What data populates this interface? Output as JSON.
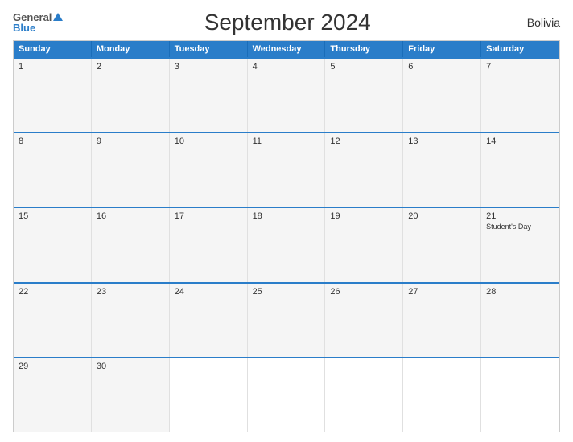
{
  "header": {
    "logo_general": "General",
    "logo_blue": "Blue",
    "title": "September 2024",
    "country": "Bolivia"
  },
  "day_headers": [
    "Sunday",
    "Monday",
    "Tuesday",
    "Wednesday",
    "Thursday",
    "Friday",
    "Saturday"
  ],
  "weeks": [
    [
      {
        "day": "1",
        "holiday": ""
      },
      {
        "day": "2",
        "holiday": ""
      },
      {
        "day": "3",
        "holiday": ""
      },
      {
        "day": "4",
        "holiday": ""
      },
      {
        "day": "5",
        "holiday": ""
      },
      {
        "day": "6",
        "holiday": ""
      },
      {
        "day": "7",
        "holiday": ""
      }
    ],
    [
      {
        "day": "8",
        "holiday": ""
      },
      {
        "day": "9",
        "holiday": ""
      },
      {
        "day": "10",
        "holiday": ""
      },
      {
        "day": "11",
        "holiday": ""
      },
      {
        "day": "12",
        "holiday": ""
      },
      {
        "day": "13",
        "holiday": ""
      },
      {
        "day": "14",
        "holiday": ""
      }
    ],
    [
      {
        "day": "15",
        "holiday": ""
      },
      {
        "day": "16",
        "holiday": ""
      },
      {
        "day": "17",
        "holiday": ""
      },
      {
        "day": "18",
        "holiday": ""
      },
      {
        "day": "19",
        "holiday": ""
      },
      {
        "day": "20",
        "holiday": ""
      },
      {
        "day": "21",
        "holiday": "Student's Day"
      }
    ],
    [
      {
        "day": "22",
        "holiday": ""
      },
      {
        "day": "23",
        "holiday": ""
      },
      {
        "day": "24",
        "holiday": ""
      },
      {
        "day": "25",
        "holiday": ""
      },
      {
        "day": "26",
        "holiday": ""
      },
      {
        "day": "27",
        "holiday": ""
      },
      {
        "day": "28",
        "holiday": ""
      }
    ],
    [
      {
        "day": "29",
        "holiday": ""
      },
      {
        "day": "30",
        "holiday": ""
      },
      {
        "day": "",
        "holiday": ""
      },
      {
        "day": "",
        "holiday": ""
      },
      {
        "day": "",
        "holiday": ""
      },
      {
        "day": "",
        "holiday": ""
      },
      {
        "day": "",
        "holiday": ""
      }
    ]
  ]
}
